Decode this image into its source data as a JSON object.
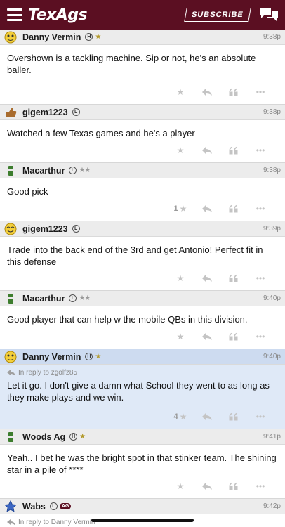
{
  "header": {
    "logo": "TexAgs",
    "subscribe_label": "SUBSCRIBE"
  },
  "colors": {
    "brand": "#5b0f22",
    "highlight": "#dfe9f7"
  },
  "posts": [
    {
      "user": "Danny Vermin",
      "avatar": "emoji-face-icon",
      "badge": "H",
      "stars": "★",
      "time": "9:38p",
      "text": "Overshown is a tackling machine. Sip or not, he's an absolute baller.",
      "likes": ""
    },
    {
      "user": "gigem1223",
      "avatar": "thumbs-up-icon",
      "badge": "L",
      "stars": "",
      "time": "9:38p",
      "text": "Watched a few Texas games and he's a player",
      "likes": ""
    },
    {
      "user": "Macarthur",
      "avatar": "beer-can-icon",
      "badge": "L",
      "stars": "★★",
      "time": "9:38p",
      "text": "Good pick",
      "likes": "1"
    },
    {
      "user": "gigem1223",
      "avatar": "smiley-icon",
      "badge": "L",
      "stars": "",
      "time": "9:39p",
      "text": "Trade into the back end of the 3rd and get Antonio! Perfect fit in this defense",
      "likes": ""
    },
    {
      "user": "Macarthur",
      "avatar": "beer-can-icon",
      "badge": "L",
      "stars": "★★",
      "time": "9:40p",
      "text": "Good player that can help w the mobile QBs in this division.",
      "likes": ""
    },
    {
      "user": "Danny Vermin",
      "avatar": "emoji-face-icon",
      "badge": "H",
      "stars": "★",
      "time": "9:40p",
      "reply_to": "In reply to zgolfz85",
      "text": "Let it go. I don't give a damn what School they went to as long as they make plays and we win.",
      "likes": "4"
    },
    {
      "user": "Woods Ag",
      "avatar": "beer-can-icon",
      "badge": "H",
      "stars": "★",
      "time": "9:41p",
      "text": "Yeah.. I bet he was the bright spot in that stinker team. The shining star in a pile of ****",
      "likes": ""
    },
    {
      "user": "Wabs",
      "avatar": "star-icon",
      "badge": "L",
      "ag": "AG",
      "stars": "",
      "time": "9:42p",
      "reply_to": "In reply to Danny Vermin"
    }
  ]
}
